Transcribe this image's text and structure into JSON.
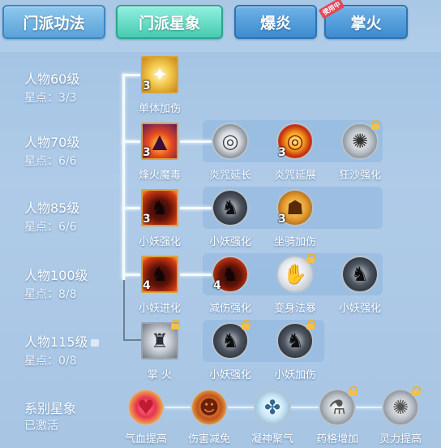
{
  "tabs": [
    {
      "label": "门派功法"
    },
    {
      "label": "门派星象"
    },
    {
      "label": "爆炎"
    },
    {
      "label": "掌火",
      "badge": "使用中"
    }
  ],
  "levels": [
    {
      "name": "人物60级",
      "points": "星点：3/3"
    },
    {
      "name": "人物70级",
      "points": "星点：6/6"
    },
    {
      "name": "人物85级",
      "points": "星点：6/6"
    },
    {
      "name": "人物100级",
      "points": "星点：8/8"
    },
    {
      "name": "人物115级",
      "points": "星点：0/8"
    }
  ],
  "nodes": {
    "r1": [
      {
        "label": "单体加伤",
        "count": "3",
        "icon": "sword-icon"
      }
    ],
    "r2": [
      {
        "label": "烽火魔毒",
        "count": "3",
        "icon": "fire-tower-icon"
      },
      {
        "label": "炎咒延长",
        "count": "",
        "icon": "white-ring-icon"
      },
      {
        "label": "炎咒延展",
        "count": "3",
        "icon": "fire-ring-icon"
      },
      {
        "label": "狂沙强化",
        "count": "",
        "icon": "sand-icon",
        "locked": true
      }
    ],
    "r3": [
      {
        "label": "小妖强化",
        "count": "3",
        "icon": "demon-icon"
      },
      {
        "label": "小妖强化",
        "count": "",
        "icon": "demon-dark-icon"
      },
      {
        "label": "坐骑加伤",
        "count": "3",
        "icon": "mount-icon"
      }
    ],
    "r4": [
      {
        "label": "小妖进化",
        "count": "4",
        "icon": "demon-icon"
      },
      {
        "label": "减伤强化",
        "count": "4",
        "icon": "demon-fire-icon"
      },
      {
        "label": "变身法暴",
        "count": "",
        "icon": "transform-icon",
        "locked": true
      },
      {
        "label": "小妖强化",
        "count": "",
        "icon": "demon-dark-icon"
      }
    ],
    "r5": [
      {
        "label": "掌 火",
        "count": "",
        "icon": "armor-icon",
        "locked": true
      },
      {
        "label": "小妖强化",
        "count": "",
        "icon": "demon-dark-icon",
        "locked": true
      },
      {
        "label": "小妖加伤",
        "count": "",
        "icon": "demon-dark-icon",
        "locked": true
      }
    ]
  },
  "series_stars": {
    "title": "系别星象",
    "status": "已激活",
    "items": [
      {
        "label": "气血提高",
        "icon": "heart-icon"
      },
      {
        "label": "伤害减免",
        "icon": "shield-man-icon"
      },
      {
        "label": "凝神聚气",
        "icon": "meditate-icon"
      },
      {
        "label": "药格增加",
        "icon": "potion-icon",
        "locked": true
      },
      {
        "label": "灵力提高",
        "icon": "spirit-icon",
        "locked": true
      }
    ]
  }
}
